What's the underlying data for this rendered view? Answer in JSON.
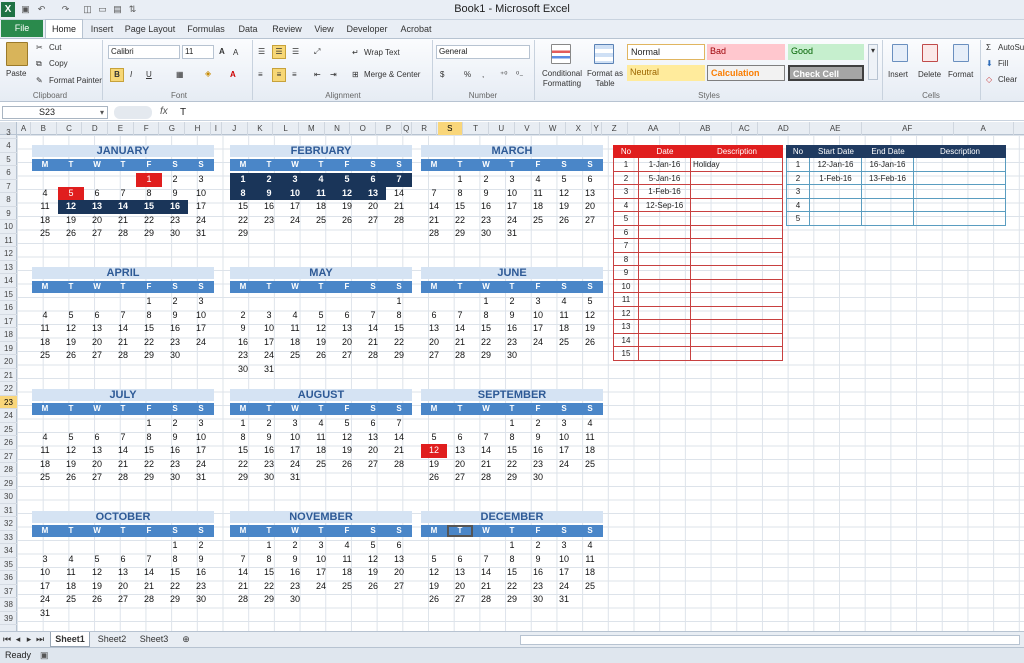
{
  "window": {
    "title": "Book1  -  Microsoft Excel"
  },
  "ribbon_tabs": [
    "File",
    "Home",
    "Insert",
    "Page Layout",
    "Formulas",
    "Data",
    "Review",
    "View",
    "Developer",
    "Acrobat"
  ],
  "clipboard": {
    "paste": "Paste",
    "cut": "Cut",
    "copy": "Copy",
    "format_painter": "Format Painter",
    "label": "Clipboard"
  },
  "font": {
    "name": "Calibri",
    "size": "11",
    "label": "Font"
  },
  "alignment": {
    "wrap": "Wrap Text",
    "merge": "Merge & Center",
    "label": "Alignment"
  },
  "number": {
    "format": "General",
    "label": "Number",
    "currency": "$",
    "percent": "%",
    "comma": ","
  },
  "styles": {
    "conditional": "Conditional Formatting",
    "format_table": "Format as Table",
    "normal": "Normal",
    "bad": "Bad",
    "good": "Good",
    "neutral": "Neutral",
    "calculation": "Calculation",
    "check_cell": "Check Cell",
    "label": "Styles"
  },
  "cells": {
    "insert": "Insert",
    "delete": "Delete",
    "format": "Format",
    "label": "Cells"
  },
  "editing": {
    "autosum": "AutoSum",
    "fill": "Fill",
    "clear": "Clear"
  },
  "formula_bar": {
    "name_box": "S23",
    "fx": "fx",
    "value": "T"
  },
  "columns": [
    "A",
    "B",
    "C",
    "D",
    "E",
    "F",
    "G",
    "H",
    "I",
    "J",
    "K",
    "L",
    "M",
    "N",
    "O",
    "P",
    "Q",
    "R",
    "S",
    "T",
    "U",
    "V",
    "W",
    "X",
    "Y",
    "Z",
    "AA",
    "AB",
    "AC",
    "AD",
    "AE",
    "AF",
    "A"
  ],
  "rows": [
    "3",
    "4",
    "5",
    "6",
    "7",
    "8",
    "9",
    "10",
    "11",
    "12",
    "13",
    "14",
    "15",
    "16",
    "17",
    "18",
    "19",
    "20",
    "21",
    "22",
    "23",
    "24",
    "25",
    "26",
    "27",
    "28",
    "29",
    "30",
    "31",
    "32",
    "33",
    "34",
    "35",
    "36",
    "37",
    "38",
    "39"
  ],
  "dayheaders": [
    "M",
    "T",
    "W",
    "T",
    "F",
    "S",
    "S"
  ],
  "months": [
    {
      "name": "JANUARY",
      "weeks": [
        [
          "",
          "",
          "",
          "",
          "1",
          "2",
          "3"
        ],
        [
          "4",
          "5",
          "6",
          "7",
          "8",
          "9",
          "10"
        ],
        [
          "11",
          "12",
          "13",
          "14",
          "15",
          "16",
          "17"
        ],
        [
          "18",
          "19",
          "20",
          "21",
          "22",
          "23",
          "24"
        ],
        [
          "25",
          "26",
          "27",
          "28",
          "29",
          "30",
          "31"
        ]
      ]
    },
    {
      "name": "FEBRUARY",
      "weeks": [
        [
          "1",
          "2",
          "3",
          "4",
          "5",
          "6",
          "7"
        ],
        [
          "8",
          "9",
          "10",
          "11",
          "12",
          "13",
          "14"
        ],
        [
          "15",
          "16",
          "17",
          "18",
          "19",
          "20",
          "21"
        ],
        [
          "22",
          "23",
          "24",
          "25",
          "26",
          "27",
          "28"
        ],
        [
          "29",
          "",
          "",
          "",
          "",
          "",
          ""
        ]
      ]
    },
    {
      "name": "MARCH",
      "weeks": [
        [
          "",
          "1",
          "2",
          "3",
          "4",
          "5",
          "6"
        ],
        [
          "7",
          "8",
          "9",
          "10",
          "11",
          "12",
          "13"
        ],
        [
          "14",
          "15",
          "16",
          "17",
          "18",
          "19",
          "20"
        ],
        [
          "21",
          "22",
          "23",
          "24",
          "25",
          "26",
          "27"
        ],
        [
          "28",
          "29",
          "30",
          "31",
          "",
          "",
          ""
        ]
      ]
    },
    {
      "name": "APRIL",
      "weeks": [
        [
          "",
          "",
          "",
          "",
          "1",
          "2",
          "3"
        ],
        [
          "4",
          "5",
          "6",
          "7",
          "8",
          "9",
          "10"
        ],
        [
          "11",
          "12",
          "13",
          "14",
          "15",
          "16",
          "17"
        ],
        [
          "18",
          "19",
          "20",
          "21",
          "22",
          "23",
          "24"
        ],
        [
          "25",
          "26",
          "27",
          "28",
          "29",
          "30",
          ""
        ]
      ]
    },
    {
      "name": "MAY",
      "weeks": [
        [
          "",
          "",
          "",
          "",
          "",
          "",
          "1"
        ],
        [
          "2",
          "3",
          "4",
          "5",
          "6",
          "7",
          "8"
        ],
        [
          "9",
          "10",
          "11",
          "12",
          "13",
          "14",
          "15"
        ],
        [
          "16",
          "17",
          "18",
          "19",
          "20",
          "21",
          "22"
        ],
        [
          "23",
          "24",
          "25",
          "26",
          "27",
          "28",
          "29"
        ],
        [
          "30",
          "31",
          "",
          "",
          "",
          "",
          ""
        ]
      ]
    },
    {
      "name": "JUNE",
      "weeks": [
        [
          "",
          "",
          "1",
          "2",
          "3",
          "4",
          "5"
        ],
        [
          "6",
          "7",
          "8",
          "9",
          "10",
          "11",
          "12"
        ],
        [
          "13",
          "14",
          "15",
          "16",
          "17",
          "18",
          "19"
        ],
        [
          "20",
          "21",
          "22",
          "23",
          "24",
          "25",
          "26"
        ],
        [
          "27",
          "28",
          "29",
          "30",
          "",
          "",
          ""
        ]
      ]
    },
    {
      "name": "JULY",
      "weeks": [
        [
          "",
          "",
          "",
          "",
          "1",
          "2",
          "3"
        ],
        [
          "4",
          "5",
          "6",
          "7",
          "8",
          "9",
          "10"
        ],
        [
          "11",
          "12",
          "13",
          "14",
          "15",
          "16",
          "17"
        ],
        [
          "18",
          "19",
          "20",
          "21",
          "22",
          "23",
          "24"
        ],
        [
          "25",
          "26",
          "27",
          "28",
          "29",
          "30",
          "31"
        ]
      ]
    },
    {
      "name": "AUGUST",
      "weeks": [
        [
          "1",
          "2",
          "3",
          "4",
          "5",
          "6",
          "7"
        ],
        [
          "8",
          "9",
          "10",
          "11",
          "12",
          "13",
          "14"
        ],
        [
          "15",
          "16",
          "17",
          "18",
          "19",
          "20",
          "21"
        ],
        [
          "22",
          "23",
          "24",
          "25",
          "26",
          "27",
          "28"
        ],
        [
          "29",
          "30",
          "31",
          "",
          "",
          "",
          ""
        ]
      ]
    },
    {
      "name": "SEPTEMBER",
      "weeks": [
        [
          "",
          "",
          "",
          "1",
          "2",
          "3",
          "4"
        ],
        [
          "5",
          "6",
          "7",
          "8",
          "9",
          "10",
          "11"
        ],
        [
          "12",
          "13",
          "14",
          "15",
          "16",
          "17",
          "18"
        ],
        [
          "19",
          "20",
          "21",
          "22",
          "23",
          "24",
          "25"
        ],
        [
          "26",
          "27",
          "28",
          "29",
          "30",
          "",
          ""
        ]
      ]
    },
    {
      "name": "OCTOBER",
      "weeks": [
        [
          "",
          "",
          "",
          "",
          "",
          "1",
          "2"
        ],
        [
          "3",
          "4",
          "5",
          "6",
          "7",
          "8",
          "9"
        ],
        [
          "10",
          "11",
          "12",
          "13",
          "14",
          "15",
          "16"
        ],
        [
          "17",
          "18",
          "19",
          "20",
          "21",
          "22",
          "23"
        ],
        [
          "24",
          "25",
          "26",
          "27",
          "28",
          "29",
          "30"
        ],
        [
          "31",
          "",
          "",
          "",
          "",
          "",
          ""
        ]
      ]
    },
    {
      "name": "NOVEMBER",
      "weeks": [
        [
          "",
          "1",
          "2",
          "3",
          "4",
          "5",
          "6"
        ],
        [
          "7",
          "8",
          "9",
          "10",
          "11",
          "12",
          "13"
        ],
        [
          "14",
          "15",
          "16",
          "17",
          "18",
          "19",
          "20"
        ],
        [
          "21",
          "22",
          "23",
          "24",
          "25",
          "26",
          "27"
        ],
        [
          "28",
          "29",
          "30",
          "",
          "",
          "",
          ""
        ]
      ]
    },
    {
      "name": "DECEMBER",
      "weeks": [
        [
          "",
          "",
          "",
          "1",
          "2",
          "3",
          "4"
        ],
        [
          "5",
          "6",
          "7",
          "8",
          "9",
          "10",
          "11"
        ],
        [
          "12",
          "13",
          "14",
          "15",
          "16",
          "17",
          "18"
        ],
        [
          "19",
          "20",
          "21",
          "22",
          "23",
          "24",
          "25"
        ],
        [
          "26",
          "27",
          "28",
          "29",
          "30",
          "31",
          ""
        ]
      ]
    }
  ],
  "holidays_table": {
    "headers": [
      "No",
      "Date",
      "Description"
    ],
    "rows": [
      [
        "1",
        "1-Jan-16",
        "Holiday"
      ],
      [
        "2",
        "5-Jan-16",
        ""
      ],
      [
        "3",
        "1-Feb-16",
        ""
      ],
      [
        "4",
        "12-Sep-16",
        ""
      ],
      [
        "5",
        "",
        ""
      ],
      [
        "6",
        "",
        ""
      ],
      [
        "7",
        "",
        ""
      ],
      [
        "8",
        "",
        ""
      ],
      [
        "9",
        "",
        ""
      ],
      [
        "10",
        "",
        ""
      ],
      [
        "11",
        "",
        ""
      ],
      [
        "12",
        "",
        ""
      ],
      [
        "13",
        "",
        ""
      ],
      [
        "14",
        "",
        ""
      ],
      [
        "15",
        "",
        ""
      ]
    ]
  },
  "ranges_table": {
    "headers": [
      "No",
      "Start Date",
      "End Date",
      "Description"
    ],
    "rows": [
      [
        "1",
        "12-Jan-16",
        "16-Jan-16",
        ""
      ],
      [
        "2",
        "1-Feb-16",
        "13-Feb-16",
        ""
      ],
      [
        "3",
        "",
        "",
        ""
      ],
      [
        "4",
        "",
        "",
        ""
      ],
      [
        "5",
        "",
        "",
        ""
      ]
    ]
  },
  "sheets": [
    "Sheet1",
    "Sheet2",
    "Sheet3"
  ],
  "status": {
    "ready": "Ready"
  }
}
